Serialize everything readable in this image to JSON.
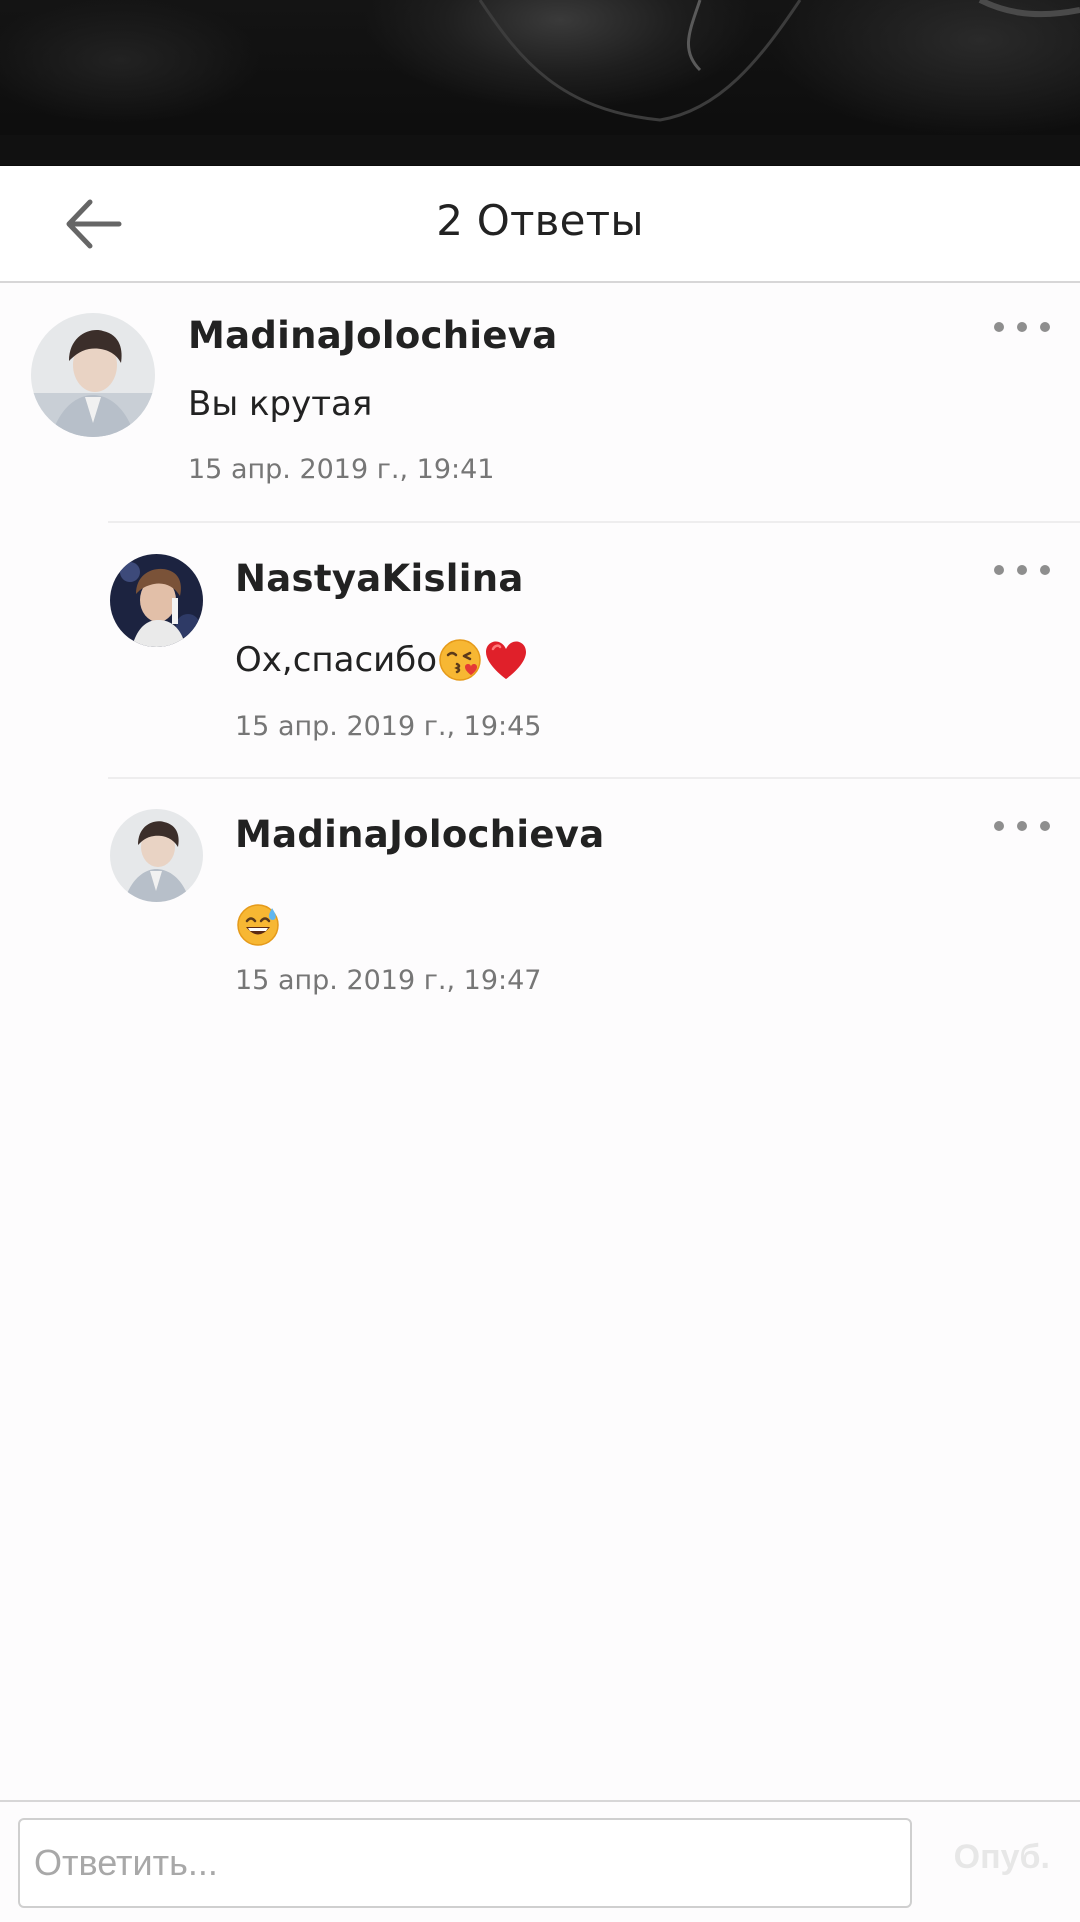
{
  "header": {
    "back_icon": "arrow-left-icon",
    "title": "2 Ответы"
  },
  "comments": [
    {
      "author": "MadinaJolochieva",
      "text": "Вы крутая",
      "time": "15 апр. 2019 г., 19:41",
      "avatar": "avatar-photo-light"
    },
    {
      "author": "NastyaKislina",
      "text": "Ох,спасибо",
      "emojis": [
        "face-blowing-kiss",
        "red-heart"
      ],
      "time": "15 апр. 2019 г., 19:45",
      "avatar": "avatar-photo-dark"
    },
    {
      "author": "MadinaJolochieva",
      "text": "",
      "emojis": [
        "grinning-face-with-sweat"
      ],
      "time": "15 апр. 2019 г., 19:47",
      "avatar": "avatar-photo-light"
    }
  ],
  "footer": {
    "reply_placeholder": "Ответить...",
    "publish_label": "Опуб."
  },
  "colors": {
    "text": "#222222",
    "muted": "#767676",
    "more_dots": "#8e8e8e",
    "publish_disabled": "#e7e7e7",
    "divider": "#d7d6d7"
  }
}
